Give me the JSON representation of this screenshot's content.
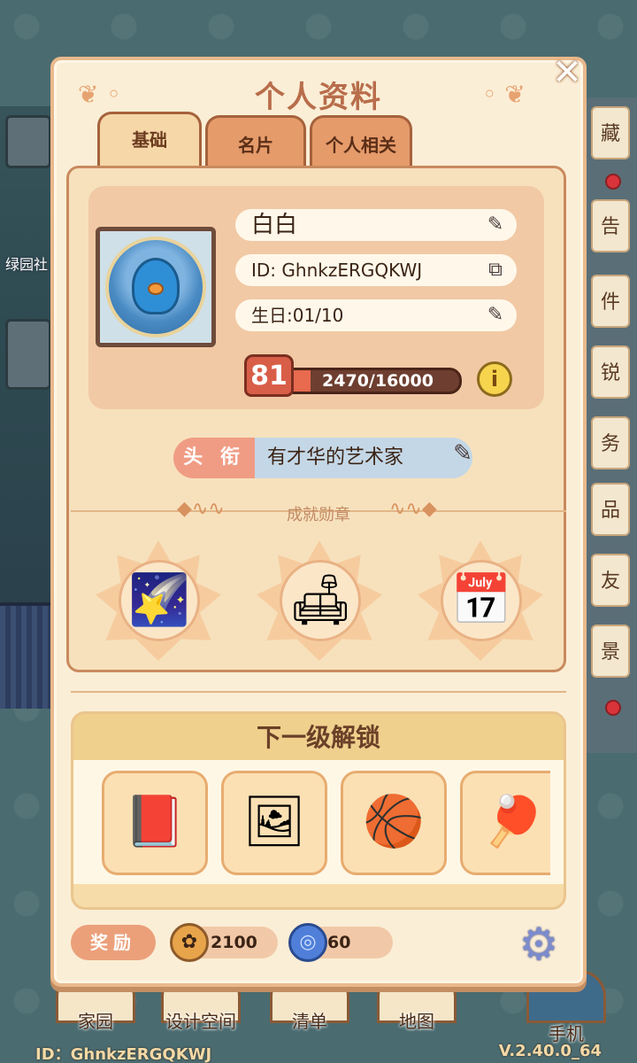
{
  "dialog": {
    "title": "个人资料",
    "tabs": [
      "基础",
      "名片",
      "个人相关"
    ],
    "active_tab": 0
  },
  "profile": {
    "name": "白白",
    "id_text": "ID: GhnkzERGQKWJ",
    "birthday": "生日:01/10",
    "level": "81",
    "xp_text": "2470/16000",
    "xp_fraction": 0.154
  },
  "title_section": {
    "label": "头 衔",
    "value": "有才华的艺术家"
  },
  "achievements": {
    "label": "成就勋章",
    "badges": [
      {
        "icon": "shooting-star-scroll-icon",
        "glyph": "🌠"
      },
      {
        "icon": "armchair-icon",
        "glyph": "🛋"
      },
      {
        "icon": "calendar-check-icon",
        "glyph": "📅"
      }
    ]
  },
  "next_unlock": {
    "title": "下一级解锁",
    "items": [
      {
        "icon": "bookshelf-icon",
        "glyph": "📕"
      },
      {
        "icon": "chalkboard-easel-icon",
        "glyph": "🖼"
      },
      {
        "icon": "basketball-icon",
        "glyph": "🏀"
      },
      {
        "icon": "ping-pong-icon",
        "glyph": "🏓"
      }
    ]
  },
  "rewards": {
    "label": "奖励",
    "coins": "2100",
    "gems": "60"
  },
  "bottom_nav": [
    "家园",
    "设计空间",
    "清单",
    "地图",
    "手机"
  ],
  "footer": {
    "id": "ID：GhnkzERGQKWJ",
    "version": "V.2.40.0_64"
  },
  "background": {
    "left_label": "绿园社",
    "right_items": [
      "藏",
      "告",
      "件",
      "锐",
      "务",
      "品",
      "友",
      "景"
    ]
  },
  "colors": {
    "dialog_bg": "#fbeed6",
    "accent": "#b86d4b",
    "title_label": "#f09c84",
    "title_value_bg": "#c4d7e6",
    "xp_fill": "#e86a4f"
  }
}
